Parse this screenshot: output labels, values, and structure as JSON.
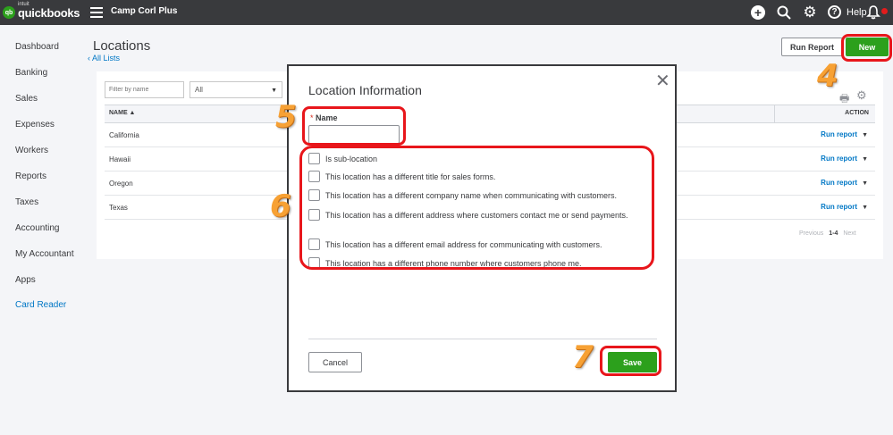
{
  "topbar": {
    "logo_brand": "quickbooks",
    "logo_maker": "intuit",
    "logo_mark": "qb",
    "company_name": "Camp Corl Plus",
    "help_label": "Help",
    "icons": [
      "plus-icon",
      "search-icon",
      "gear-icon",
      "help-icon",
      "bell-icon"
    ]
  },
  "sidebar": {
    "items": [
      {
        "label": "Dashboard"
      },
      {
        "label": "Banking"
      },
      {
        "label": "Sales"
      },
      {
        "label": "Expenses"
      },
      {
        "label": "Workers"
      },
      {
        "label": "Reports"
      },
      {
        "label": "Taxes"
      },
      {
        "label": "Accounting"
      },
      {
        "label": "My Accountant"
      },
      {
        "label": "Apps"
      },
      {
        "label": "Card Reader"
      }
    ]
  },
  "page": {
    "title": "Locations",
    "back_link": "‹ All Lists",
    "run_report_label": "Run Report",
    "new_label": "New"
  },
  "filters": {
    "search_placeholder": "Filter by name",
    "select_value": "All"
  },
  "table": {
    "col_name": "NAME ▲",
    "col_action": "ACTION",
    "rows": [
      {
        "name": "California",
        "action": "Run report"
      },
      {
        "name": "Hawaii",
        "action": "Run report"
      },
      {
        "name": "Oregon",
        "action": "Run report"
      },
      {
        "name": "Texas",
        "action": "Run report"
      }
    ],
    "pager_prev": "Previous",
    "pager_range": "1-4",
    "pager_next": "Next"
  },
  "modal": {
    "title": "Location Information",
    "name_required_mark": "*",
    "name_label": "Name",
    "name_value": "",
    "checkboxes": [
      {
        "label": "Is sub-location",
        "checked": false
      },
      {
        "label": "This location has a different title for sales forms.",
        "checked": false
      },
      {
        "label": "This location has a different company name when communicating with customers.",
        "checked": false
      },
      {
        "label": "This location has a different address where customers contact me or send payments.",
        "checked": false
      },
      {
        "label": "This location has a different email address for communicating with customers.",
        "checked": false
      },
      {
        "label": "This location has a different phone number where customers phone me.",
        "checked": false
      }
    ],
    "cancel_label": "Cancel",
    "save_label": "Save"
  },
  "annotations": {
    "step_new": "4",
    "step_name": "5",
    "step_checkboxes": "6",
    "step_save": "7",
    "highlight_color": "#e8161b",
    "number_color": "#f7a134"
  },
  "colors": {
    "brand_green": "#2ca01c",
    "link_blue": "#0077c5",
    "topbar_bg": "#393a3d"
  }
}
